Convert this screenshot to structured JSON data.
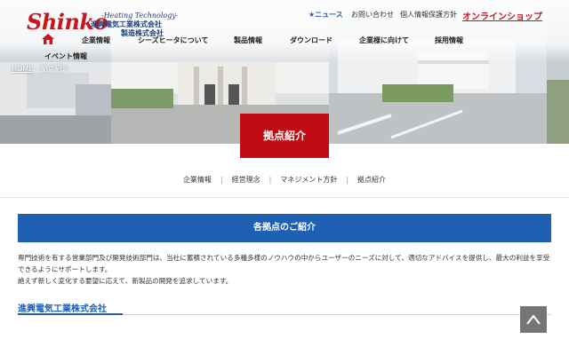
{
  "logo": {
    "word": "Shinko",
    "tagline": "-Heating Technology-",
    "company_line1": "進興電気工業株式会社",
    "company_line2": "製造株式会社"
  },
  "utility_links": {
    "news": "★ニュース",
    "contact": "お問い合わせ",
    "privacy": "個人情報保護方針",
    "shop": "オンラインショップ"
  },
  "nav": {
    "items": [
      "企業情報",
      "シーズヒータについて",
      "製品情報",
      "ダウンロード",
      "企業様に向けて",
      "採用情報",
      "イベント情報"
    ]
  },
  "breadcrumb": {
    "home": "HOME",
    "sep": " › ",
    "current": "拠点紹介"
  },
  "hero": {
    "title": "拠点紹介"
  },
  "subnav": {
    "items": [
      "企業情報",
      "経営理念",
      "マネジメント方針",
      "拠点紹介"
    ],
    "separator": "|"
  },
  "section": {
    "title": "各拠点のご紹介"
  },
  "intro": {
    "line1": "専門技術を有する営業部門及び開発技術部門は、当社に蓄積されている多種多様のノウハウの中からユーザーのニーズに対して、適切なアドバイスを提供し、最大の利益を享受できるようにサポートします。",
    "line2": "絶えず新しく変化する要望に応えて、新製品の開発を追求しています。"
  },
  "company": {
    "name": "進興電気工業株式会社"
  },
  "icons": {
    "logo_house": "house-icon",
    "back_to_top": "chevron-up-icon"
  },
  "colors": {
    "brand_red": "#c8161d",
    "hero_title_bg": "#c00c12",
    "section_blue": "#1f5fb4",
    "totop_gray": "#757575"
  }
}
